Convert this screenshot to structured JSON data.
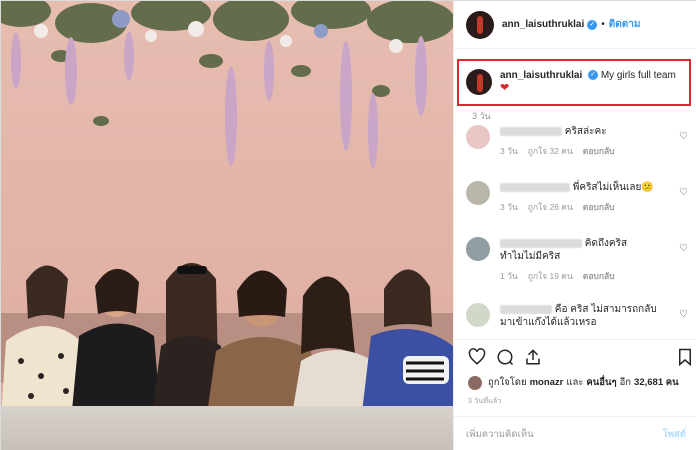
{
  "header": {
    "username": "ann_laisuthruklai",
    "follow_label": "ติดตาม"
  },
  "caption": {
    "username": "ann_laisuthruklai",
    "text": "My girls full team",
    "emoji": "❤",
    "time": "3 วัน"
  },
  "comments": [
    {
      "text": "คริสล่ะคะ",
      "time": "3 วัน",
      "likes": "ถูกใจ 32 คน",
      "reply": "ตอบกลับ",
      "avatar_color": "#e8c6c4"
    },
    {
      "text": "พี่คริสไม่เห็นเลย😕",
      "time": "3 วัน",
      "likes": "ถูกใจ 26 คน",
      "reply": "ตอบกลับ",
      "avatar_color": "#b9b6a8"
    },
    {
      "text": "คิดถึงคริส",
      "text2": "ทำไมไม่มีคริส",
      "time": "1 วัน",
      "likes": "ถูกใจ 19 คน",
      "reply": "ตอบกลับ",
      "avatar_color": "#8f9ea3"
    },
    {
      "text": "คือ คริส ไม่สามารถกลับ",
      "text2": "มาเข้าแก๊งได้แล้วเหรอ",
      "avatar_color": "#d2d8c9"
    }
  ],
  "likes": {
    "prefix": "ถูกใจโดย",
    "user": "monazr",
    "middle": "และ",
    "others": "คนอื่นๆ",
    "suffix": "อีก",
    "count": "32,681 คน"
  },
  "post_time": "3 วันที่แล้ว",
  "add_comment": {
    "placeholder": "เพิ่มความคิดเห็น",
    "post_label": "โพสต์"
  },
  "icons": {
    "like": "heart-outline-icon",
    "comment": "comment-bubble-icon",
    "share": "share-icon",
    "save": "bookmark-icon"
  },
  "colors": {
    "accent": "#3897f0",
    "highlight_box": "#d9272e"
  }
}
